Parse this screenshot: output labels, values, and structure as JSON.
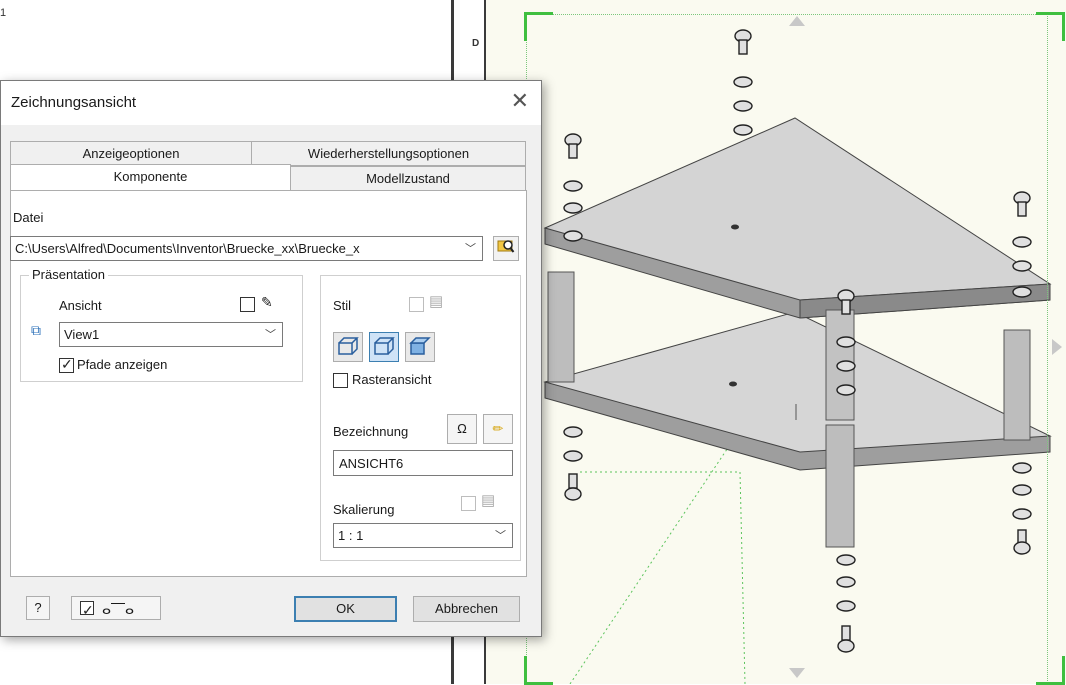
{
  "background": {
    "zone_letter": "D",
    "top_mark": "1"
  },
  "dialog": {
    "title": "Zeichnungsansicht",
    "tabs_back": [
      "Anzeigeoptionen",
      "Wiederherstellungsoptionen"
    ],
    "tabs_front": [
      "Komponente",
      "Modellzustand"
    ],
    "active_tab": "Komponente",
    "file_label": "Datei",
    "file_path": "C:\\Users\\Alfred\\Documents\\Inventor\\Bruecke_xx\\Bruecke_x",
    "presentation_group": "Präsentation",
    "view_label": "Ansicht",
    "view_value": "View1",
    "show_paths_label": "Pfade anzeigen",
    "show_paths_checked": true,
    "style_label": "Stil",
    "raster_label": "Rasteransicht",
    "raster_checked": false,
    "designation_label": "Bezeichnung",
    "designation_value": "ANSICHT6",
    "scale_label": "Skalierung",
    "scale_value": "1 : 1",
    "ok_label": "OK",
    "cancel_label": "Abbrechen",
    "help_icon": "help-icon",
    "preview_checked": true
  }
}
